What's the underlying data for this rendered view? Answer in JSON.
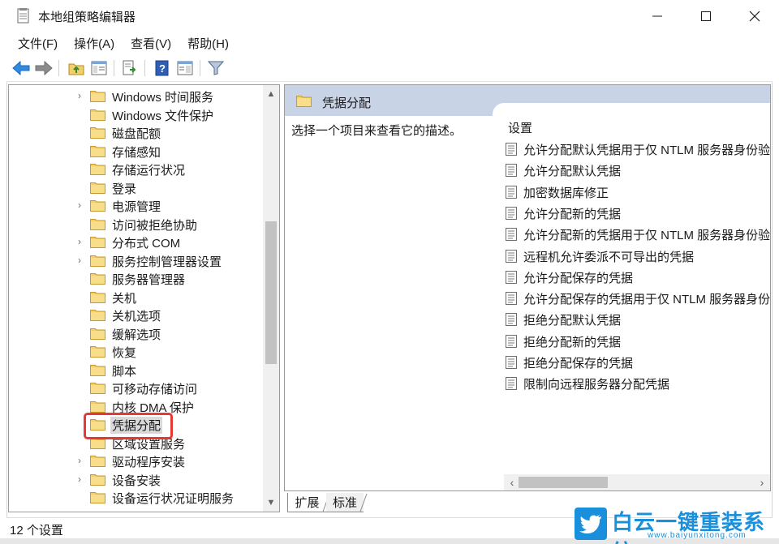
{
  "window": {
    "title": "本地组策略编辑器"
  },
  "menu": [
    "文件(F)",
    "操作(A)",
    "查看(V)",
    "帮助(H)"
  ],
  "tree": {
    "items": [
      {
        "label": "Windows 时间服务",
        "expandable": true
      },
      {
        "label": "Windows 文件保护",
        "expandable": false
      },
      {
        "label": "磁盘配额",
        "expandable": false
      },
      {
        "label": "存储感知",
        "expandable": false
      },
      {
        "label": "存储运行状况",
        "expandable": false
      },
      {
        "label": "登录",
        "expandable": false
      },
      {
        "label": "电源管理",
        "expandable": true
      },
      {
        "label": "访问被拒绝协助",
        "expandable": false
      },
      {
        "label": "分布式 COM",
        "expandable": true
      },
      {
        "label": "服务控制管理器设置",
        "expandable": true
      },
      {
        "label": "服务器管理器",
        "expandable": false
      },
      {
        "label": "关机",
        "expandable": false
      },
      {
        "label": "关机选项",
        "expandable": false
      },
      {
        "label": "缓解选项",
        "expandable": false
      },
      {
        "label": "恢复",
        "expandable": false
      },
      {
        "label": "脚本",
        "expandable": false
      },
      {
        "label": "可移动存储访问",
        "expandable": false
      },
      {
        "label": "内核 DMA 保护",
        "expandable": false
      },
      {
        "label": "凭据分配",
        "expandable": false,
        "selected": true
      },
      {
        "label": "区域设置服务",
        "expandable": false
      },
      {
        "label": "驱动程序安装",
        "expandable": true
      },
      {
        "label": "设备安装",
        "expandable": true
      },
      {
        "label": "设备运行状况证明服务",
        "expandable": false
      }
    ]
  },
  "right": {
    "header_title": "凭据分配",
    "description": "选择一个项目来查看它的描述。",
    "column_header": "设置",
    "settings": [
      "允许分配默认凭据用于仅 NTLM 服务器身份验",
      "允许分配默认凭据",
      "加密数据库修正",
      "允许分配新的凭据",
      "允许分配新的凭据用于仅 NTLM 服务器身份验",
      "远程机允许委派不可导出的凭据",
      "允许分配保存的凭据",
      "允许分配保存的凭据用于仅 NTLM 服务器身份",
      "拒绝分配默认凭据",
      "拒绝分配新的凭据",
      "拒绝分配保存的凭据",
      "限制向远程服务器分配凭据"
    ]
  },
  "tabs": [
    "扩展",
    "标准"
  ],
  "status": "12 个设置",
  "watermark": {
    "text": "白云一键重装系统",
    "url": "www.baiyunxitong.com"
  },
  "colors": {
    "header_blue": "#c8d3e6",
    "highlight_red": "#e53935",
    "folder_yellow": "#f3cf6a",
    "watermark_blue": "#1a8fdc"
  },
  "icons": {
    "back": "arrow-left-icon",
    "forward": "arrow-right-icon",
    "up": "folder-up-icon",
    "show_hide": "console-tree-icon",
    "export": "export-list-icon",
    "help": "help-icon",
    "properties": "properties-icon",
    "filter": "filter-icon"
  }
}
